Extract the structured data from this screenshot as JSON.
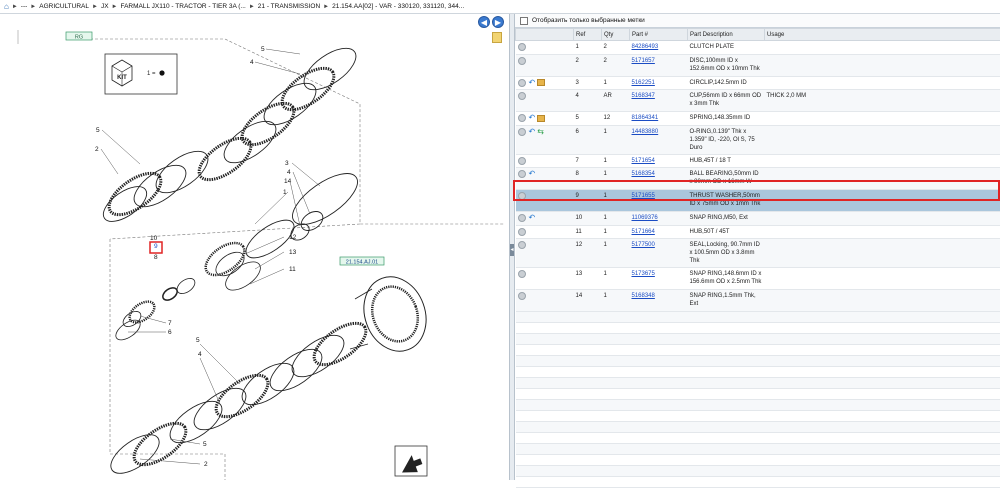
{
  "breadcrumb": {
    "items": [
      "---",
      "AGRICULTURAL",
      "JX",
      "FARMALL JX110 - TRACTOR - TIER 3A (...",
      "21 - TRANSMISSION",
      "21.154.AA[02] - VAR - 330120, 331120, 344..."
    ]
  },
  "diagram": {
    "tag_top": "RG",
    "kit_label": "KIT",
    "kit_qty": "1 =",
    "link_label": "21.154.AJ.01",
    "callouts": [
      "5",
      "4",
      "5",
      "2",
      "3",
      "4",
      "14",
      "1",
      "10",
      "9",
      "8",
      "12",
      "13",
      "11",
      "7",
      "6",
      "5",
      "4",
      "5",
      "2"
    ]
  },
  "filter": {
    "label": "Отобразить только выбранные метки"
  },
  "table": {
    "headers": [
      "",
      "Ref",
      "Qty",
      "Part #",
      "Part Description",
      "Usage"
    ],
    "rows": [
      {
        "ref": "1",
        "qty": "2",
        "part": "84286493",
        "desc": "CLUTCH PLATE",
        "usage": "",
        "icons": []
      },
      {
        "ref": "2",
        "qty": "2",
        "part": "5171657",
        "desc": "DISC,100mm ID x 152.6mm OD x 10mm Thk",
        "usage": "",
        "icons": []
      },
      {
        "ref": "3",
        "qty": "1",
        "part": "5162251",
        "desc": "CIRCLIP,142.5mm ID",
        "usage": "",
        "icons": [
          "undo",
          "box"
        ]
      },
      {
        "ref": "4",
        "qty": "AR",
        "part": "5168347",
        "desc": "CUP,56mm ID x 66mm OD x 3mm Thk",
        "usage": "THICK 2,0 MM",
        "icons": []
      },
      {
        "ref": "5",
        "qty": "12",
        "part": "81864341",
        "desc": "SPRING,148.35mm ID",
        "usage": "",
        "icons": [
          "undo",
          "box"
        ]
      },
      {
        "ref": "6",
        "qty": "1",
        "part": "14483880",
        "desc": "O-RING,0.139\" Thk x 1.359\" ID, -220, Ol S, 75 Duro",
        "usage": "",
        "icons": [
          "undo",
          "swap"
        ]
      },
      {
        "ref": "7",
        "qty": "1",
        "part": "5171654",
        "desc": "HUB,45T / 18 T",
        "usage": "",
        "icons": []
      },
      {
        "ref": "8",
        "qty": "1",
        "part": "5168354",
        "desc": "BALL BEARING,50mm ID x 80mm OD x 16mm W",
        "usage": "",
        "icons": [
          "undo"
        ]
      },
      {
        "ref": "9",
        "qty": "1",
        "part": "5171655",
        "desc": "THRUST WASHER,50mm ID x 75mm OD x 1mm Thk",
        "usage": "",
        "icons": [],
        "selected": true
      },
      {
        "ref": "10",
        "qty": "1",
        "part": "11069376",
        "desc": "SNAP RING,M50, Ext",
        "usage": "",
        "icons": [
          "undo"
        ]
      },
      {
        "ref": "11",
        "qty": "1",
        "part": "5171664",
        "desc": "HUB,50T / 45T",
        "usage": "",
        "icons": []
      },
      {
        "ref": "12",
        "qty": "1",
        "part": "5177500",
        "desc": "SEAL,Locking, 90.7mm ID x 100.5mm OD x 3.8mm Thk",
        "usage": "",
        "icons": []
      },
      {
        "ref": "13",
        "qty": "1",
        "part": "5173675",
        "desc": "SNAP RING,148.6mm ID x 156.6mm OD x 2.5mm Thk",
        "usage": "",
        "icons": []
      },
      {
        "ref": "14",
        "qty": "1",
        "part": "5168348",
        "desc": "SNAP RING,1.5mm Thk, Ext",
        "usage": "",
        "icons": []
      }
    ]
  },
  "colors": {
    "accent": "#3a7ad0",
    "selection": "#aac6dc",
    "highlight": "#e02424",
    "link": "#1a4cc4"
  }
}
